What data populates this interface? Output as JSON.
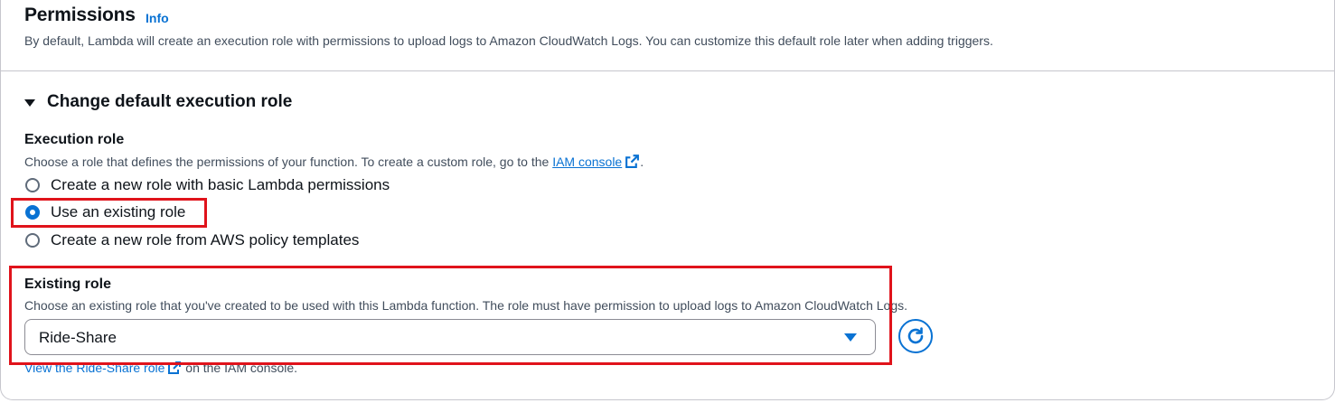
{
  "permissions": {
    "title": "Permissions",
    "info": "Info",
    "description": "By default, Lambda will create an execution role with permissions to upload logs to Amazon CloudWatch Logs. You can customize this default role later when adding triggers."
  },
  "expander": {
    "label": "Change default execution role",
    "expanded": true
  },
  "execution_role": {
    "label": "Execution role",
    "description_prefix": "Choose a role that defines the permissions of your function. To create a custom role, go to the",
    "console_link": "IAM console",
    "description_suffix": ".",
    "options": [
      {
        "label": "Create a new role with basic Lambda permissions",
        "checked": false
      },
      {
        "label": "Use an existing role",
        "checked": true
      },
      {
        "label": "Create a new role from AWS policy templates",
        "checked": false
      }
    ]
  },
  "existing_role": {
    "label": "Existing role",
    "description": "Choose an existing role that you've created to be used with this Lambda function. The role must have permission to upload logs to Amazon CloudWatch Logs.",
    "selected": "Ride-Share",
    "view_link": "View the Ride-Share role",
    "view_suffix": "on the IAM console."
  },
  "icons": {
    "external": "external-link-icon",
    "refresh": "refresh-icon",
    "caret": "caret-down-icon"
  },
  "colors": {
    "link": "#0972d3",
    "highlight": "#e0131b",
    "text": "#0f141a",
    "secondary_text": "#414d5c"
  }
}
